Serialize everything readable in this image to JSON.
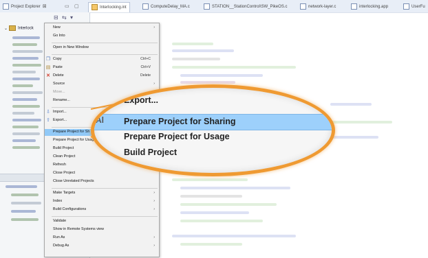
{
  "tabs": [
    {
      "label": "Project Explorer",
      "close": "⊠"
    },
    {
      "label": "Interlocking.int"
    },
    {
      "label": "ComputeDelay_MA.c"
    },
    {
      "label": "STATION__StationControl\\SW_PikeOS.c"
    },
    {
      "label": "network-layer.c"
    },
    {
      "label": "interlocking.app"
    },
    {
      "label": "UserFu"
    }
  ],
  "tree": {
    "root_label": "Interlock"
  },
  "menu": {
    "items": [
      {
        "id": "new",
        "label": "New",
        "submenu": true
      },
      {
        "id": "go-into",
        "label": "Go Into"
      },
      {
        "id": "open-new-window",
        "label": "Open in New Window"
      },
      {
        "id": "copy",
        "label": "Copy",
        "shortcut": "Ctrl+C",
        "icon": "copy-icon"
      },
      {
        "id": "paste",
        "label": "Paste",
        "shortcut": "Ctrl+V",
        "icon": "paste-icon"
      },
      {
        "id": "delete",
        "label": "Delete",
        "shortcut": "Delete",
        "icon": "delete-icon"
      },
      {
        "id": "source",
        "label": "Source",
        "submenu": true
      },
      {
        "id": "move",
        "label": "Move..."
      },
      {
        "id": "rename",
        "label": "Rename...",
        "shortcut": "F2"
      },
      {
        "id": "import",
        "label": "Import...",
        "icon": "import-icon"
      },
      {
        "id": "export",
        "label": "Export...",
        "icon": "export-icon"
      },
      {
        "id": "prepare-sharing",
        "label": "Prepare Project for Sh"
      },
      {
        "id": "prepare-usage",
        "label": "Prepare Project for Usage"
      },
      {
        "id": "build-project",
        "label": "Build Project"
      },
      {
        "id": "clean-project",
        "label": "Clean Project"
      },
      {
        "id": "refresh",
        "label": "Refresh",
        "shortcut": "F5"
      },
      {
        "id": "close-project",
        "label": "Close Project"
      },
      {
        "id": "close-unrelated",
        "label": "Close Unrelated Projects"
      },
      {
        "id": "make-targets",
        "label": "Make Targets",
        "submenu": true
      },
      {
        "id": "index",
        "label": "Index",
        "submenu": true
      },
      {
        "id": "build-configs",
        "label": "Build Configurations",
        "submenu": true
      },
      {
        "id": "validate",
        "label": "Validate"
      },
      {
        "id": "show-remote",
        "label": "Show in Remote Systems view"
      },
      {
        "id": "run-as",
        "label": "Run As",
        "submenu": true
      },
      {
        "id": "debug-as",
        "label": "Debug As",
        "submenu": true
      }
    ],
    "submenu_arrow": "›"
  },
  "lens": {
    "items": [
      "Export...",
      "Prepare Project for Sharing",
      "Prepare Project for Usage",
      "Build Project"
    ],
    "side_letter": "Al"
  },
  "colors": {
    "highlight": "#91c9f7",
    "callout": "#ef9a32"
  }
}
